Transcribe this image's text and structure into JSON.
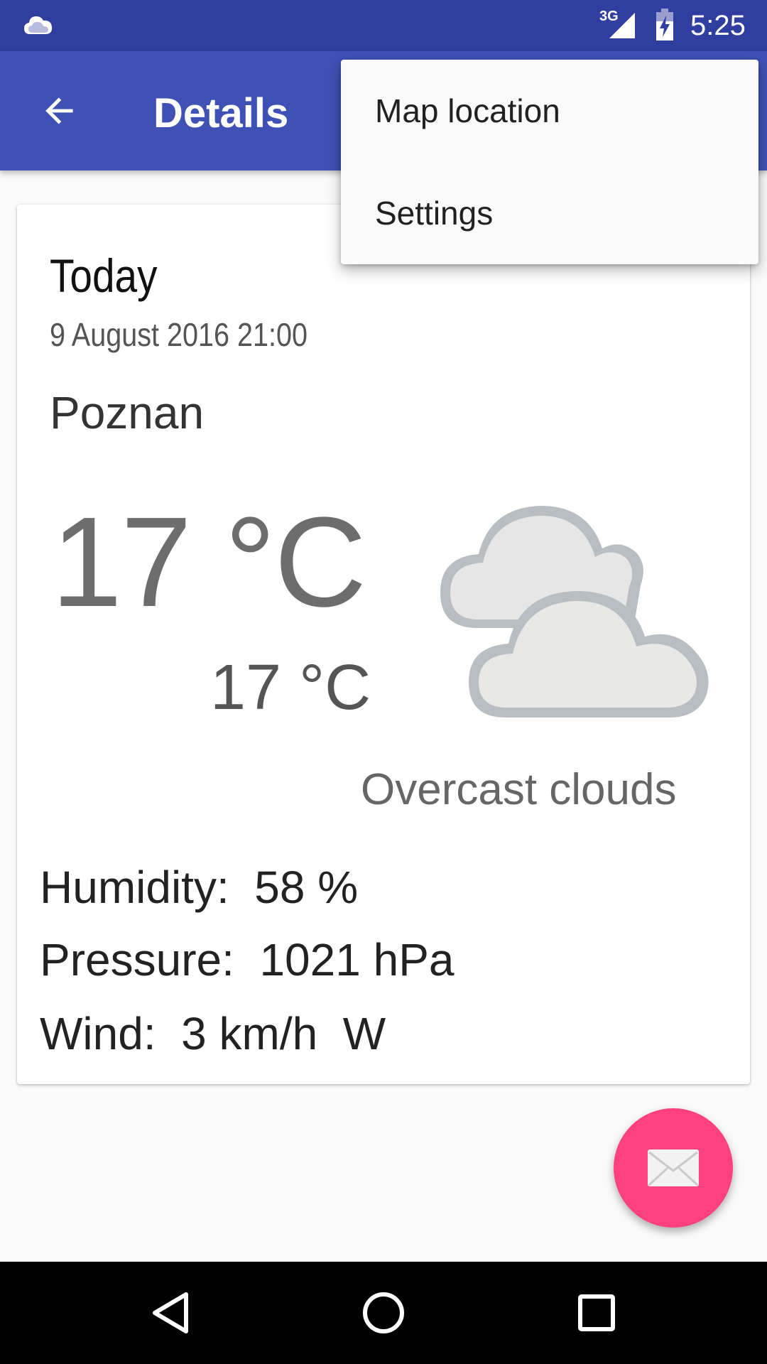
{
  "status_bar": {
    "network_type": "3G",
    "time": "5:25",
    "icons": [
      "cloud-notification-icon",
      "signal-icon",
      "battery-charging-icon"
    ]
  },
  "app_bar": {
    "title": "Details",
    "back_icon": "arrow-back-icon"
  },
  "overflow_menu": {
    "items": [
      {
        "label": "Map location"
      },
      {
        "label": "Settings"
      }
    ]
  },
  "forecast": {
    "day": "Today",
    "date": "9 August 2016 21:00",
    "city": "Poznan",
    "temp_high": "17 °C",
    "temp_low": "17 °C",
    "condition": "Overcast clouds",
    "condition_icon": "overcast-clouds-icon",
    "humidity": "Humidity:  58 %",
    "pressure": "Pressure:  1021 hPa",
    "wind": "Wind:  3 km/h  W"
  },
  "fab": {
    "icon": "email-icon",
    "color": "#ff4081"
  },
  "nav_bar": {
    "icons": [
      "nav-back-icon",
      "nav-home-icon",
      "nav-recents-icon"
    ]
  },
  "colors": {
    "primary": "#3f51b5",
    "primary_dark": "#303f9f",
    "accent": "#ff4081"
  }
}
